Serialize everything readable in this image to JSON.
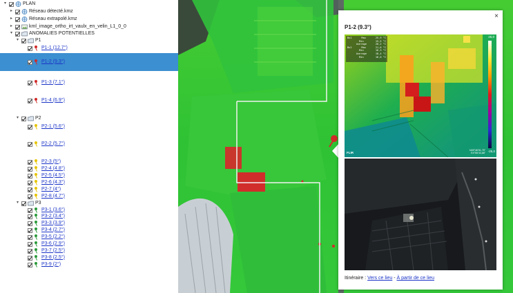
{
  "tree": {
    "root": "PLAN",
    "layers": [
      "Réseau détecté.kmz",
      "Réseau extrapolé.kmz",
      "kml_image_ortho_irt_vaulx_en_velin_L1_0_0"
    ],
    "anomalies_folder": "ANOMALIES POTENTIELLES",
    "groups": [
      {
        "name": "P1",
        "items": [
          {
            "label": "P1-1 (12.7°)",
            "color": "red"
          },
          {
            "label": "P1-2 (9.3°)",
            "color": "red"
          },
          {
            "label": "P1-3 (7.1°)",
            "color": "red"
          },
          {
            "label": "P1-4 (6.9°)",
            "color": "red"
          }
        ]
      },
      {
        "name": "P2",
        "items": [
          {
            "label": "P2-1 (5.6°)",
            "color": "yellow"
          },
          {
            "label": "P2-2 (5.7°)",
            "color": "yellow"
          },
          {
            "label": "P2-3 (5°)",
            "color": "yellow"
          },
          {
            "label": "P2-4 (4.8°)",
            "color": "yellow"
          },
          {
            "label": "P2-5 (4.5°)",
            "color": "yellow"
          },
          {
            "label": "P2-6 (4.3°)",
            "color": "yellow"
          },
          {
            "label": "P2-7 (4°)",
            "color": "yellow"
          },
          {
            "label": "P2-8 (4.7°)",
            "color": "yellow"
          }
        ]
      },
      {
        "name": "P3",
        "items": [
          {
            "label": "P3-1 (3.6°)",
            "color": "green"
          },
          {
            "label": "P3-2 (3.4°)",
            "color": "green"
          },
          {
            "label": "P3-3 (3.9°)",
            "color": "green"
          },
          {
            "label": "P3-4 (2.7°)",
            "color": "green"
          },
          {
            "label": "P3-5 (2.2°)",
            "color": "green"
          },
          {
            "label": "P3-6 (2.9°)",
            "color": "green"
          },
          {
            "label": "P3-7 (2.5°)",
            "color": "green"
          },
          {
            "label": "P3-8 (2.5°)",
            "color": "green"
          },
          {
            "label": "P3-9 (2°)",
            "color": "green"
          }
        ]
      }
    ],
    "selected": "P1-2 (9.3°)"
  },
  "colors": {
    "selection": "#3c8fd0",
    "link": "#1a33c7",
    "pin_red": "#d12a2a",
    "pin_yellow": "#e6c400",
    "pin_green": "#2a9a3a",
    "map_green": "#2fc42f",
    "hotspot": "#d9262a"
  },
  "popup": {
    "close": "×",
    "title": "P1-2 (9.3°)",
    "thermal": {
      "max": "25,0",
      "min": "-25,0",
      "logo": "FLIR",
      "coords_line1": "N45°46'51,75\"",
      "coords_line2": "E4°55'43,88\"",
      "readouts": [
        {
          "tag": "Bx1",
          "name": "Max",
          "value": "25,9 °C"
        },
        {
          "tag": "",
          "name": "Min",
          "value": "15,5 °C"
        },
        {
          "tag": "",
          "name": "Average",
          "value": "20,2 °C"
        },
        {
          "tag": "Bx2",
          "name": "Max",
          "value": "21,6 °C"
        },
        {
          "tag": "",
          "name": "Min",
          "value": "16,3 °C"
        },
        {
          "tag": "",
          "name": "Average",
          "value": "18,4 °C"
        },
        {
          "tag": "",
          "name": "Min",
          "value": "16,0 °C"
        }
      ]
    },
    "itinerary": {
      "label": "Itinéraire :",
      "to_here": "Vers ce lieu",
      "separator": "-",
      "from_here": "À partir de ce lieu"
    }
  }
}
